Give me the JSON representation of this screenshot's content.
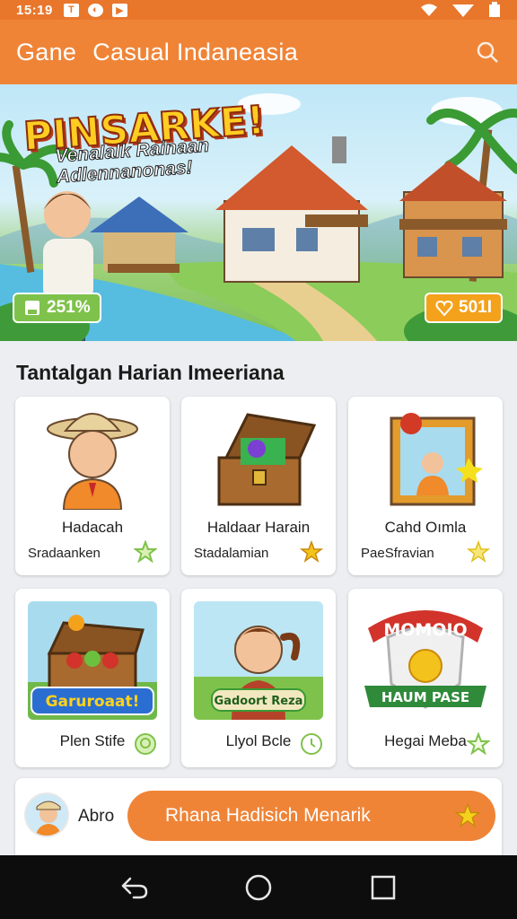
{
  "status": {
    "time": "15:19",
    "icons": [
      "notification-icon",
      "vpn-icon",
      "play-icon"
    ],
    "right_icons": [
      "wifi-icon",
      "signal-icon",
      "battery-icon"
    ]
  },
  "appbar": {
    "title_part1": "Gane",
    "title_part2": "Casual Indaneasia",
    "search_icon": "search-icon"
  },
  "banner": {
    "title": "PINSARKE!",
    "subtitle_line1": "Venalalk Rainaan",
    "subtitle_line2": "Adlennanonas!",
    "badge_left": "251%",
    "badge_right": "501I"
  },
  "section": {
    "title": "Tantalgan Harian Imeeriana"
  },
  "cards": [
    {
      "name": "Hadacah",
      "sub": "Sradaanken",
      "star": "green-star"
    },
    {
      "name": "Haldaar Harain",
      "sub": "Stadalamian",
      "star": "gold-star"
    },
    {
      "name": "Cahd Oımla",
      "sub": "PaeSfravian",
      "star": "gold-star"
    },
    {
      "name": "Plen Stife",
      "star": "green-chat"
    },
    {
      "name": "Llyol Bcle",
      "star": "green-clock"
    },
    {
      "name": "Hegai Meba",
      "star": "green-star"
    }
  ],
  "card_art_text": {
    "chest_label": "Garuroaat!",
    "girl_label": "Gadoort Reza",
    "badge_top": "MOMOIO",
    "badge_bottom": "HAUM PASE"
  },
  "bottom": {
    "name": "Abro",
    "cta": "Rhana Hadisich Menarik"
  },
  "colors": {
    "accent": "#ef8437",
    "green": "#7fc24b",
    "gold": "#f4c21c"
  }
}
